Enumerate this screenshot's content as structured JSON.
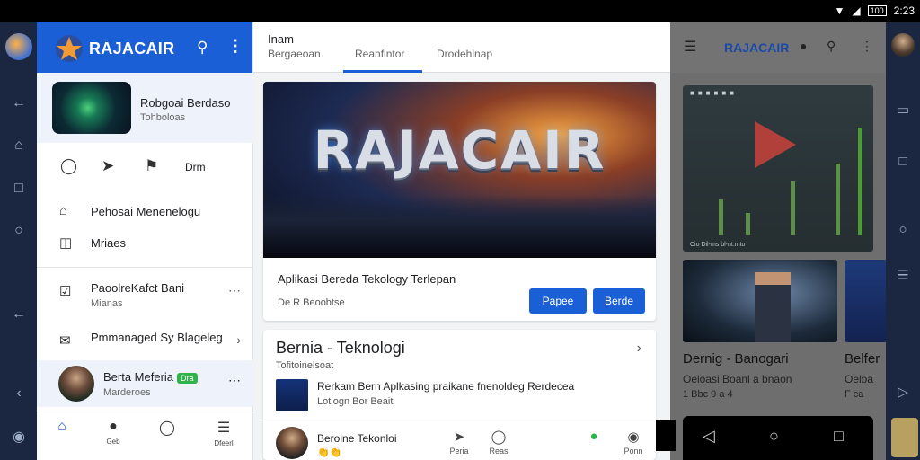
{
  "status_bar": {
    "time": "2:23",
    "battery": "100"
  },
  "left_panel": {
    "app_title": "RAJACAIR",
    "featured": {
      "title": "Robgoai Berdaso",
      "subtitle": "Tohboloas"
    },
    "action_label": "Drm",
    "menu": [
      {
        "label": "Pehosai Menenelogu"
      },
      {
        "label": "Mriaes"
      }
    ],
    "items": [
      {
        "title": "PaoolreKafct Bani",
        "sub": "Mianas"
      },
      {
        "title": "Pmmanaged Sy Blageleg",
        "sub": ""
      }
    ],
    "user": {
      "name": "Berta Meferia",
      "badge": "Dra",
      "sub": "Marderoes"
    },
    "bottom_nav": [
      {
        "label": ""
      },
      {
        "label": "Geb"
      },
      {
        "label": ""
      },
      {
        "label": "Dfeerl"
      }
    ]
  },
  "center_panel": {
    "header_label": "Inam",
    "tabs": [
      {
        "label": "Bergaeoan"
      },
      {
        "label": "Reanfintor"
      },
      {
        "label": "Drodehlnap"
      }
    ],
    "hero": {
      "banner_text": "RAJACAIR",
      "caption": "Aplikasi Bereda Tekology Terlepan",
      "meta": "De  R  Beoobtse",
      "button1": "Papee",
      "button2": "Berde"
    },
    "news": {
      "heading": "Bernia - Teknologi",
      "subheading": "Tofitoinelsoat",
      "item_title": "Rerkam Bern Aplkasing praikane fnenoldeg Rerdecea",
      "item_meta": "Lotlogn Bor Beait",
      "author_name": "Beroine Tekonloi",
      "author_emoji": "👏👏",
      "actions": [
        {
          "label": "Peria"
        },
        {
          "label": "Reas"
        },
        {
          "label": ""
        },
        {
          "label": "Ponn"
        }
      ]
    }
  },
  "right_panel": {
    "app_title": "RAJACAIR",
    "chart_label": "Cio  Dil-ms  bl-nt.mto",
    "card1": {
      "title": "Dernig - Banogari",
      "sub": "Oeloasi Boanl a bnaon",
      "meta": "1 Bbc 9 a 4"
    },
    "card2": {
      "title": "Belfer",
      "sub": "Oeloa",
      "meta": "F ca"
    }
  },
  "colors": {
    "accent": "#1a5fd6",
    "rail": "#1b2740",
    "badge": "#2fb34a"
  }
}
